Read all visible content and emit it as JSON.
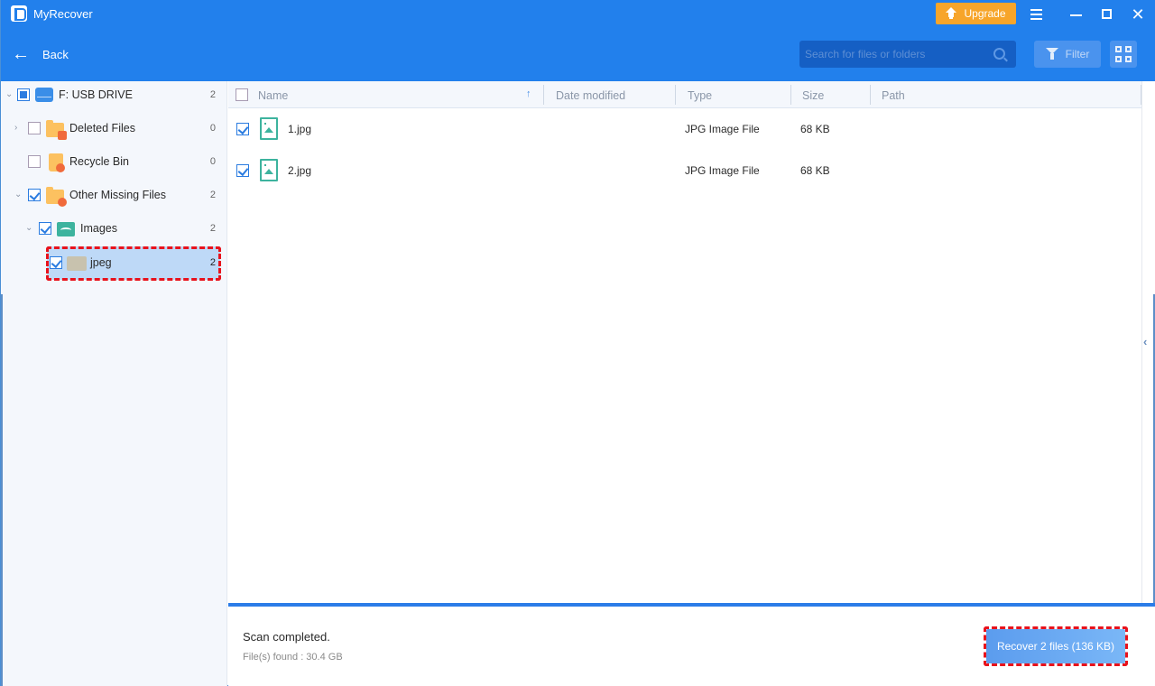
{
  "app": {
    "title": "MyRecover",
    "upgrade_label": "Upgrade",
    "icons": {
      "logo": "myrecover-logo",
      "menu": "hamburger-menu-icon",
      "minimize": "minimize-icon",
      "maximize": "maximize-icon",
      "close": "close-icon"
    }
  },
  "toolbar": {
    "back_label": "Back",
    "back_glyph": "←",
    "search_placeholder": "Search for files or folders",
    "search_value": "",
    "filter_label": "Filter"
  },
  "sidebar": {
    "tree": [
      {
        "label": "F: USB DRIVE",
        "count": "2",
        "icon": "usb-drive-icon",
        "state": "partial",
        "expanded": true,
        "level": 0
      },
      {
        "label": "Deleted Files",
        "count": "0",
        "icon": "deleted-files-folder-icon",
        "state": "unchecked",
        "expanded": false,
        "level": 1
      },
      {
        "label": "Recycle Bin",
        "count": "0",
        "icon": "recycle-bin-icon",
        "state": "unchecked",
        "level": 1
      },
      {
        "label": "Other Missing Files",
        "count": "2",
        "icon": "missing-files-folder-icon",
        "state": "checked",
        "expanded": true,
        "level": 1
      },
      {
        "label": "Images",
        "count": "2",
        "icon": "images-icon",
        "state": "checked",
        "expanded": true,
        "level": 2
      },
      {
        "label": "jpeg",
        "count": "2",
        "icon": "folder-icon",
        "state": "checked",
        "selected": true,
        "level": 3
      }
    ]
  },
  "table": {
    "columns": [
      "Name",
      "Date modified",
      "Type",
      "Size",
      "Path"
    ],
    "sort": {
      "column": "Name",
      "direction": "ascending",
      "glyph": "↑"
    },
    "rows": [
      {
        "name": "1.jpg",
        "date_modified": "",
        "type": "JPG Image File",
        "size": "68 KB",
        "path": "",
        "checked": true
      },
      {
        "name": "2.jpg",
        "date_modified": "",
        "type": "JPG Image File",
        "size": "68 KB",
        "path": "",
        "checked": true
      }
    ]
  },
  "footer": {
    "status": "Scan completed.",
    "files_found": "File(s) found : 30.4 GB",
    "recover_label": "Recover 2 files (136 KB)"
  },
  "colors": {
    "header_blue": "#2280ec",
    "upgrade_orange": "#f7a52a",
    "highlight_red": "#e8121c",
    "selected_row": "#bed9f7"
  }
}
